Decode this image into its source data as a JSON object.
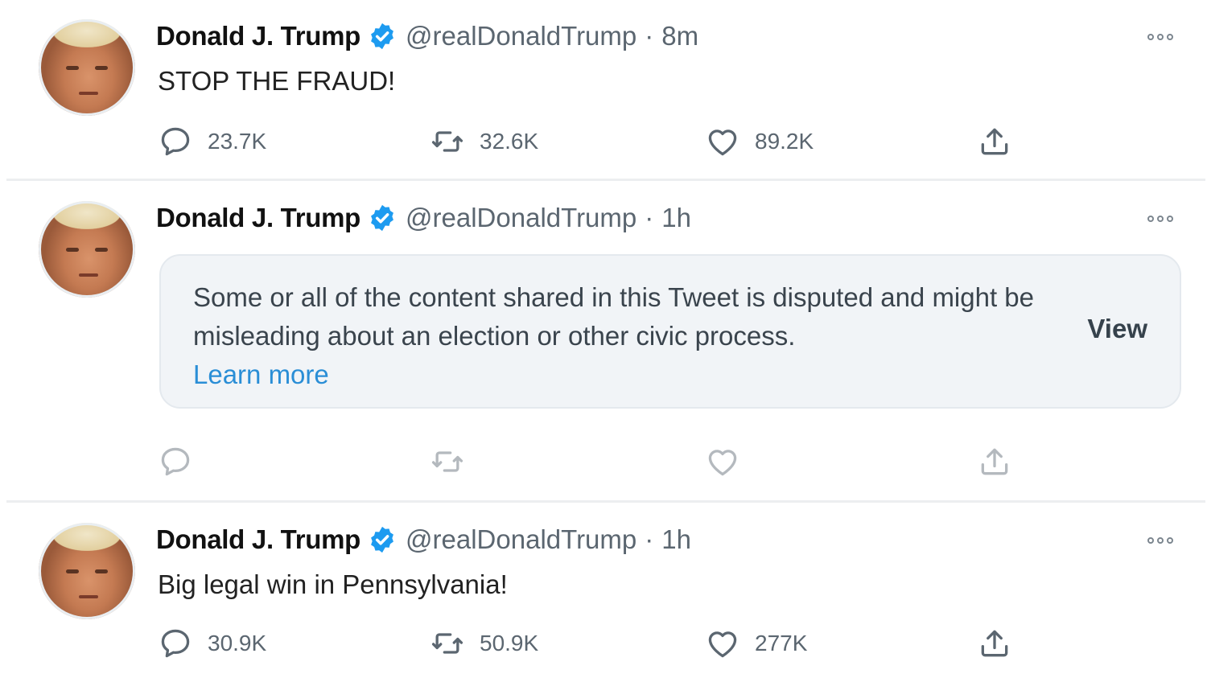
{
  "tweets": [
    {
      "name": "Donald J. Trump",
      "handle": "@realDonaldTrump",
      "time": "8m",
      "text": "STOP THE FRAUD!",
      "replies": "23.7K",
      "retweets": "32.6K",
      "likes": "89.2K"
    },
    {
      "name": "Donald J. Trump",
      "handle": "@realDonaldTrump",
      "time": "1h",
      "notice_text": "Some or all of the content shared in this Tweet is disputed and might be misleading about an election or other civic process.",
      "learn_more": "Learn more",
      "view_label": "View"
    },
    {
      "name": "Donald J. Trump",
      "handle": "@realDonaldTrump",
      "time": "1h",
      "text": "Big legal win in Pennsylvania!",
      "replies": "30.9K",
      "retweets": "50.9K",
      "likes": "277K"
    }
  ],
  "separator": "·",
  "colors": {
    "verified": "#1d9bf0",
    "link": "#2a8ed6",
    "muted_text": "#5b6670",
    "notice_bg": "#f1f4f7"
  },
  "icons": [
    "reply-icon",
    "retweet-icon",
    "like-icon",
    "share-icon",
    "verified-badge-icon",
    "more-options-icon"
  ]
}
